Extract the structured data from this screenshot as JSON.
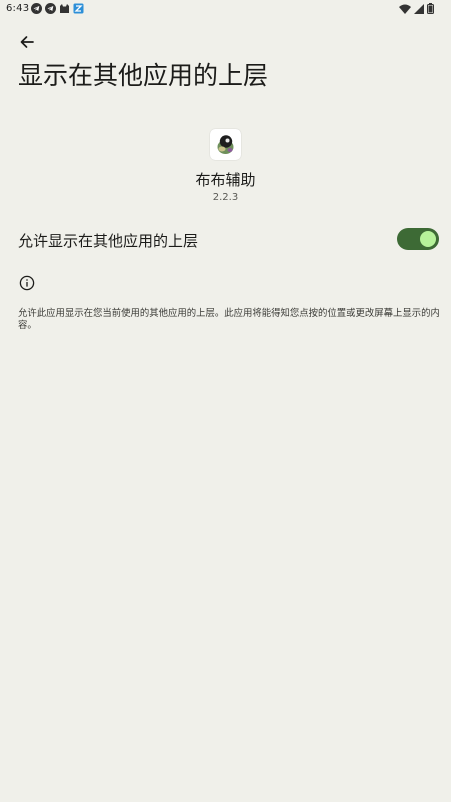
{
  "status_bar": {
    "time": "6:43",
    "notification_icons": [
      "telegram-icon",
      "telegram-icon",
      "cat-icon",
      "app-icon"
    ],
    "system_icons": [
      "wifi-icon",
      "signal-icon",
      "battery-icon"
    ]
  },
  "header": {
    "title": "显示在其他应用的上层"
  },
  "app": {
    "name": "布布辅助",
    "version": "2.2.3"
  },
  "permission": {
    "label": "允许显示在其他应用的上层",
    "enabled": true,
    "toggle_color": "#3d6a35",
    "thumb_color": "#b6f29a"
  },
  "info": {
    "icon": "info-icon",
    "text": "允许此应用显示在您当前使用的其他应用的上层。此应用将能得知您点按的位置或更改屏幕上显示的内容。"
  }
}
